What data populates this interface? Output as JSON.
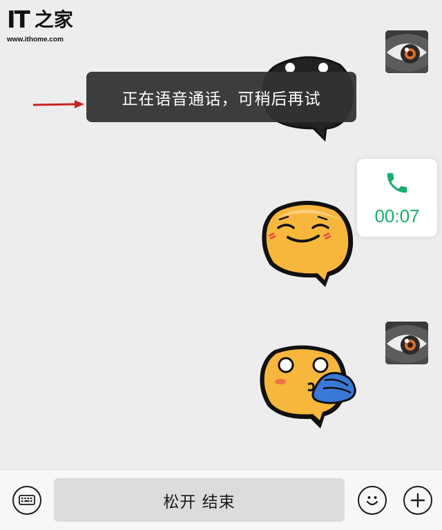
{
  "watermark": {
    "brand": "IT之家",
    "logo_it": "IT",
    "logo_cn": "之家",
    "url": "www.ithome.com"
  },
  "toast": {
    "text": "正在语音通话，可稍后再试"
  },
  "call": {
    "duration": "00:07",
    "icon": "phone-icon",
    "color": "#1aad6e"
  },
  "input": {
    "hold_label": "松开 结束",
    "keyboard_icon": "keyboard-icon",
    "emoji_icon": "emoji-icon",
    "add_icon": "plus-icon"
  },
  "messages": [
    {
      "type": "sticker",
      "sender": "self",
      "sticker": "black-face-sticker"
    },
    {
      "type": "call",
      "sender": "self"
    },
    {
      "type": "sticker",
      "sender": "self",
      "sticker": "shy-smile-sticker"
    },
    {
      "type": "sticker",
      "sender": "self",
      "sticker": "wave-hand-sticker"
    }
  ],
  "colors": {
    "background": "#ededed",
    "toast_bg": "#323232",
    "sticker_yellow": "#f6b73c",
    "accent_green": "#1aad6e",
    "arrow_red": "#cc2222"
  }
}
